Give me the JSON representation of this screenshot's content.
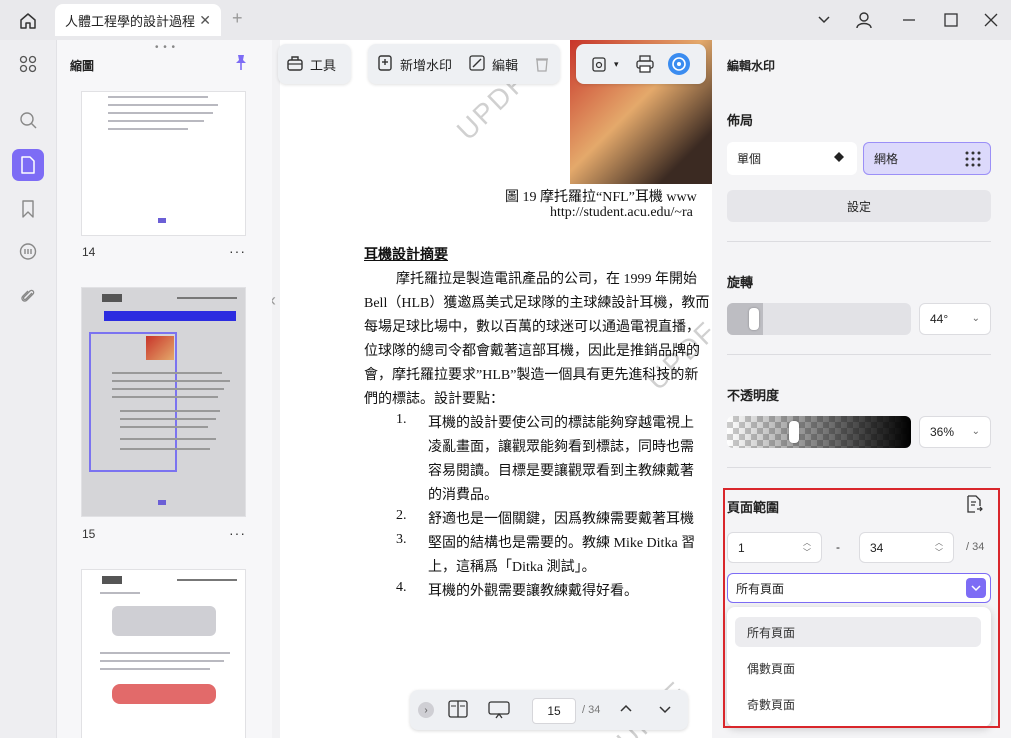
{
  "titlebar": {
    "tab_title": "人體工程學的設計過程",
    "icons": [
      "home-icon",
      "close-icon",
      "plus-icon",
      "chevron-down-icon",
      "user-icon",
      "minimize-icon",
      "maximize-icon",
      "close-window-icon"
    ]
  },
  "rail": {
    "items": [
      "grid-icon",
      "search-icon",
      "page-icon",
      "bookmark-icon",
      "comment-icon",
      "attachment-icon"
    ],
    "active_color": "#7d6cf5"
  },
  "thumbnails": {
    "title": "縮圖",
    "pages": [
      {
        "number": "14"
      },
      {
        "number": "15"
      },
      {
        "number": ""
      }
    ]
  },
  "toolbar": {
    "tools_label": "工具",
    "add_watermark_label": "新增水印",
    "edit_label": "編輯"
  },
  "document": {
    "caption_line1": "圖 19  摩托羅拉“NFL”耳機    www",
    "caption_line2": "http://student.acu.edu/~ra",
    "heading": "耳機設計摘要",
    "paragraph": [
      "摩托羅拉是製造電訊產品的公司，在 1999 年開始",
      "Bell（HLB）獲邀爲美式足球隊的主球練設計耳機，教而",
      "每場足球比場中，數以百萬的球迷可以通過電視直播，",
      "位球隊的總司令都會戴著這部耳機，因此是推銷品牌的",
      "會，摩托羅拉要求”HLB”製造一個具有更先進科技的新",
      "們的標誌。設計要點："
    ],
    "list": [
      {
        "num": "1.",
        "lines": [
          "耳機的設計要使公司的標誌能夠穿越電視上",
          "凌亂畫面，讓觀眾能夠看到標誌，同時也需",
          "容易閱讀。目標是要讓觀眾看到主教練戴著",
          "的消費品。"
        ]
      },
      {
        "num": "2.",
        "lines": [
          "舒適也是一個關鍵，因爲教練需要戴著耳機"
        ]
      },
      {
        "num": "3.",
        "lines": [
          "堅固的結構也是需要的。教練 Mike Ditka 習",
          "上，這稱爲「Ditka 測試」。"
        ]
      },
      {
        "num": "4.",
        "lines": [
          "耳機的外觀需要讓教練戴得好看。"
        ]
      }
    ],
    "watermark_text": "UPDF"
  },
  "bottom_nav": {
    "current_page": "15",
    "total_pages": "/ 34"
  },
  "right_panel": {
    "title": "編輯水印",
    "layout_label": "佈局",
    "layout_single": "單個",
    "layout_grid": "網格",
    "settings_button": "設定",
    "rotation_label": "旋轉",
    "rotation_value": "44°",
    "opacity_label": "不透明度",
    "opacity_value": "36%",
    "page_range_label": "頁面範圍",
    "range_from": "1",
    "range_dash": "-",
    "range_to": "34",
    "range_total": "/ 34",
    "range_select": "所有頁面",
    "range_options": [
      "所有頁面",
      "偶數頁面",
      "奇數頁面"
    ],
    "accent": "#7d6cf5",
    "highlight_color": "#d9262b"
  }
}
